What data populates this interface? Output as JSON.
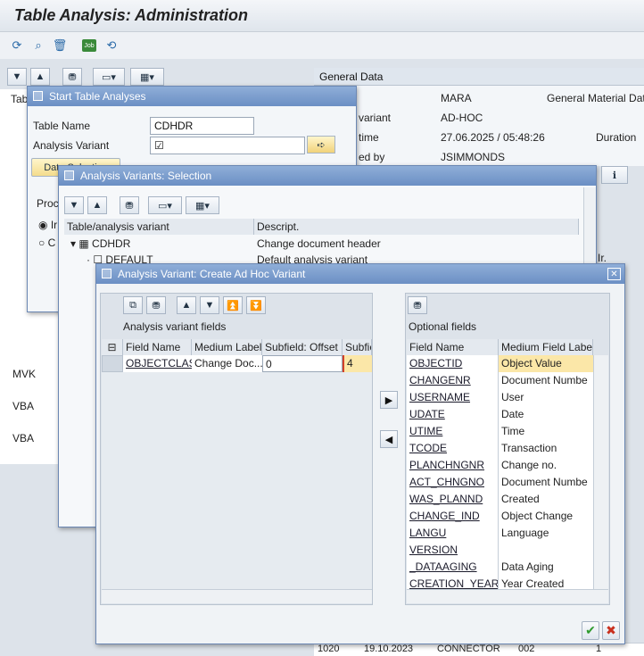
{
  "title": "Table Analysis: Administration",
  "toolbar": {
    "icons": [
      "execute-icon",
      "find-icon",
      "delete-icon",
      "job-icon",
      "refresh-icon"
    ],
    "job_label": "Job"
  },
  "general": {
    "header": "General Data",
    "rows": [
      {
        "label": "",
        "value": "MARA",
        "extra": "General Material Dat"
      },
      {
        "label": "variant",
        "value": "AD-HOC",
        "extra": ""
      },
      {
        "label": "time",
        "value": "27.06.2025 / 05:48:26",
        "extra": "Duration"
      },
      {
        "label": "ed by",
        "value": "JSIMMONDS",
        "extra": ""
      }
    ]
  },
  "background": {
    "tab_label": "Tab",
    "tree": [
      "MVK",
      "VBA",
      "VBA"
    ],
    "bottom_row": {
      "c1": "1020",
      "c2": "19.10.2023",
      "c3": "CONNECTOR",
      "c4": "002",
      "c5": "1"
    },
    "peek": "Ir."
  },
  "start_dialog": {
    "title": "Start Table Analyses",
    "table_name_label": "Table Name",
    "table_name": "CDHDR",
    "variant_label": "Analysis Variant",
    "variant_value": "☑",
    "data_selection": "Data Selection",
    "proc_label": "Proc",
    "radio1": "Ir",
    "radio2": "C"
  },
  "selection_dialog": {
    "title": "Analysis Variants: Selection",
    "col1": "Table/analysis variant",
    "col2": "Descript.",
    "rows": [
      {
        "name": "CDHDR",
        "desc": "Change document header"
      },
      {
        "name": "DEFAULT",
        "desc": "Default analysis variant"
      }
    ]
  },
  "create_dialog": {
    "title": "Analysis Variant: Create Ad Hoc Variant",
    "left_title": "Analysis variant fields",
    "left_cols": [
      "Field Name",
      "Medium Label",
      "Subfield: Offset",
      "Subfie"
    ],
    "left_rows": [
      {
        "field": "OBJECTCLAS",
        "label": "Change Doc...",
        "offset": "0",
        "len": "4"
      }
    ],
    "right_title": "Optional fields",
    "right_cols": [
      "Field Name",
      "Medium Field Labe"
    ],
    "right_rows": [
      {
        "field": "OBJECTID",
        "label": "Object Value"
      },
      {
        "field": "CHANGENR",
        "label": "Document Numbe"
      },
      {
        "field": "USERNAME",
        "label": "User"
      },
      {
        "field": "UDATE",
        "label": "Date"
      },
      {
        "field": "UTIME",
        "label": "Time"
      },
      {
        "field": "TCODE",
        "label": "Transaction"
      },
      {
        "field": "PLANCHNGNR",
        "label": "Change no."
      },
      {
        "field": "ACT_CHNGNO",
        "label": "Document Numbe"
      },
      {
        "field": "WAS_PLANND",
        "label": "Created"
      },
      {
        "field": "CHANGE_IND",
        "label": "Object Change"
      },
      {
        "field": "LANGU",
        "label": "Language"
      },
      {
        "field": "VERSION",
        "label": ""
      },
      {
        "field": "_DATAAGING",
        "label": "Data Aging"
      },
      {
        "field": "CREATION_YEAR",
        "label": "Year Created"
      }
    ],
    "ok": "✔",
    "cancel": "✖",
    "close": "✕"
  },
  "colors": {
    "title_bar": "#6b8fc4",
    "highlight": "#fbe7a8",
    "ok": "#2f9b2f",
    "cancel": "#c9301e"
  }
}
